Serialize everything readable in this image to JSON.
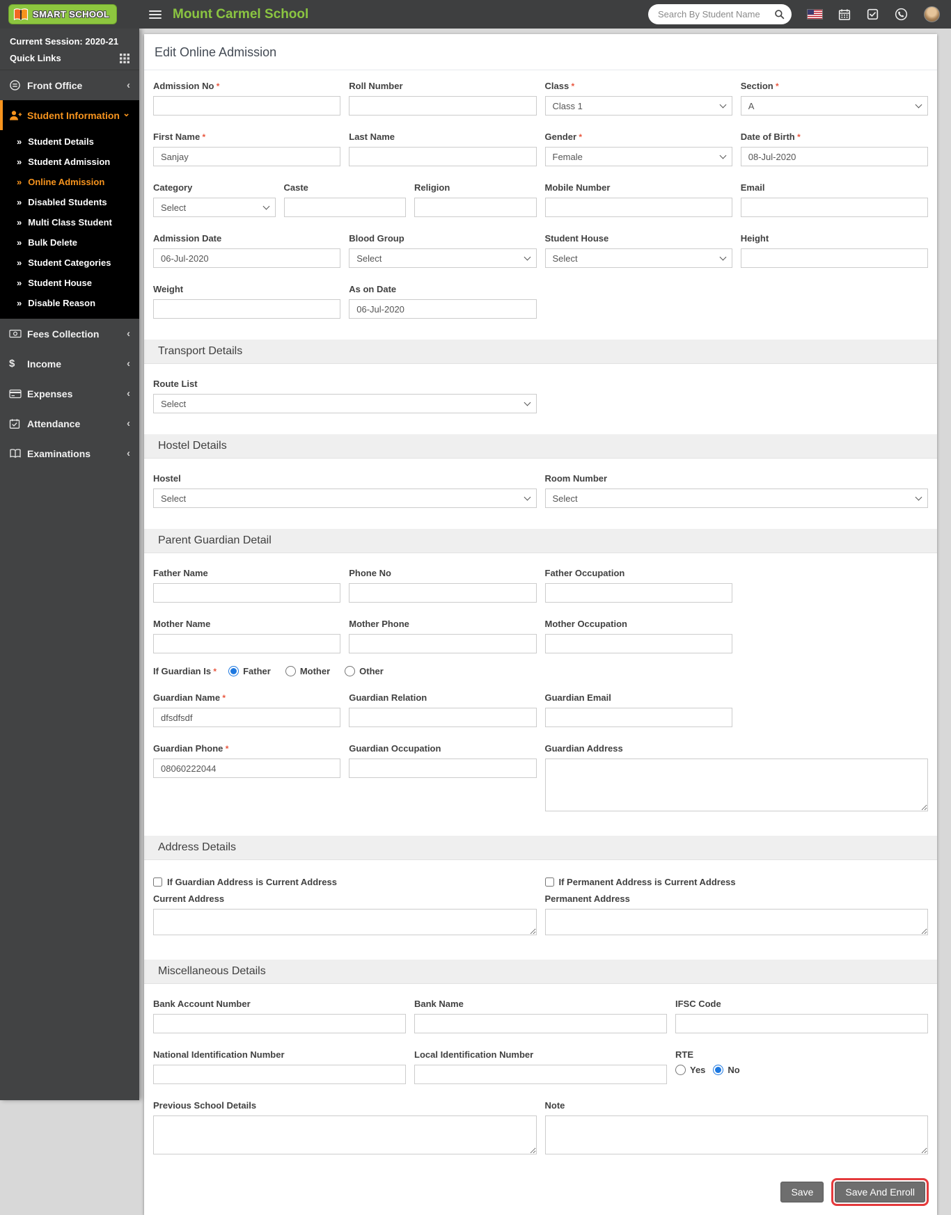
{
  "colors": {
    "accent_orange": "#f7941e",
    "brand_green": "#8bc541",
    "annotation_red": "#e43a3c",
    "radio_blue": "#1d78e0",
    "header_bg": "#3e3f40",
    "sidebar_bg": "#424344"
  },
  "header": {
    "logo_text": "SMART SCHOOL",
    "school_name": "Mount Carmel School",
    "search_placeholder": "Search By Student Name"
  },
  "sidebar": {
    "session": "Current Session: 2020-21",
    "quick_links": "Quick Links",
    "items": [
      {
        "label": "Front Office"
      },
      {
        "label": "Student Information",
        "active": true
      },
      {
        "label": "Fees Collection"
      },
      {
        "label": "Income"
      },
      {
        "label": "Expenses"
      },
      {
        "label": "Attendance"
      },
      {
        "label": "Examinations"
      }
    ],
    "student_information_children": [
      "Student Details",
      "Student Admission",
      "Online Admission",
      "Disabled Students",
      "Multi Class Student",
      "Bulk Delete",
      "Student Categories",
      "Student House",
      "Disable Reason"
    ],
    "active_child": "Online Admission"
  },
  "page": {
    "title": "Edit Online Admission"
  },
  "form": {
    "admission_no": {
      "label": "Admission No",
      "value": "",
      "required": true
    },
    "roll_number": {
      "label": "Roll Number",
      "value": ""
    },
    "class": {
      "label": "Class",
      "value": "Class 1",
      "required": true
    },
    "section": {
      "label": "Section",
      "value": "A",
      "required": true
    },
    "first_name": {
      "label": "First Name",
      "value": "Sanjay",
      "required": true
    },
    "last_name": {
      "label": "Last Name",
      "value": ""
    },
    "gender": {
      "label": "Gender",
      "value": "Female",
      "required": true
    },
    "date_of_birth": {
      "label": "Date of Birth",
      "value": "08-Jul-2020",
      "required": true
    },
    "category": {
      "label": "Category",
      "value": "Select"
    },
    "caste": {
      "label": "Caste",
      "value": ""
    },
    "religion": {
      "label": "Religion",
      "value": ""
    },
    "mobile_number": {
      "label": "Mobile Number",
      "value": ""
    },
    "email": {
      "label": "Email",
      "value": ""
    },
    "admission_date": {
      "label": "Admission Date",
      "value": "06-Jul-2020"
    },
    "blood_group": {
      "label": "Blood Group",
      "value": "Select"
    },
    "student_house": {
      "label": "Student House",
      "value": "Select"
    },
    "height": {
      "label": "Height",
      "value": ""
    },
    "weight": {
      "label": "Weight",
      "value": ""
    },
    "as_on_date": {
      "label": "As on Date",
      "value": "06-Jul-2020"
    }
  },
  "transport": {
    "title": "Transport Details",
    "route_list": {
      "label": "Route List",
      "value": "Select"
    }
  },
  "hostel": {
    "title": "Hostel Details",
    "hostel": {
      "label": "Hostel",
      "value": "Select"
    },
    "room_number": {
      "label": "Room Number",
      "value": "Select"
    }
  },
  "guardian": {
    "title": "Parent Guardian Detail",
    "father_name": {
      "label": "Father Name",
      "value": ""
    },
    "phone_no": {
      "label": "Phone No",
      "value": ""
    },
    "father_occupation": {
      "label": "Father Occupation",
      "value": ""
    },
    "mother_name": {
      "label": "Mother Name",
      "value": ""
    },
    "mother_phone": {
      "label": "Mother Phone",
      "value": ""
    },
    "mother_occupation": {
      "label": "Mother Occupation",
      "value": ""
    },
    "if_guardian_is": {
      "label": "If Guardian Is",
      "options": {
        "father": "Father",
        "mother": "Mother",
        "other": "Other"
      },
      "selected": "Father",
      "required": true
    },
    "guardian_name": {
      "label": "Guardian Name",
      "value": "dfsdfsdf",
      "required": true
    },
    "guardian_relation": {
      "label": "Guardian Relation",
      "value": ""
    },
    "guardian_email": {
      "label": "Guardian Email",
      "value": ""
    },
    "guardian_phone": {
      "label": "Guardian Phone",
      "value": "08060222044",
      "required": true
    },
    "guardian_occupation": {
      "label": "Guardian Occupation",
      "value": ""
    },
    "guardian_address": {
      "label": "Guardian Address",
      "value": ""
    }
  },
  "address": {
    "title": "Address Details",
    "guardian_is_current_checkbox": "If Guardian Address is Current Address",
    "current_address": {
      "label": "Current Address",
      "value": ""
    },
    "permanent_is_current_checkbox": "If Permanent Address is Current Address",
    "permanent_address": {
      "label": "Permanent Address",
      "value": ""
    }
  },
  "misc": {
    "title": "Miscellaneous Details",
    "bank_account_number": {
      "label": "Bank Account Number",
      "value": ""
    },
    "bank_name": {
      "label": "Bank Name",
      "value": ""
    },
    "ifsc_code": {
      "label": "IFSC Code",
      "value": ""
    },
    "national_id": {
      "label": "National Identification Number",
      "value": ""
    },
    "local_id": {
      "label": "Local Identification Number",
      "value": ""
    },
    "rte": {
      "label": "RTE",
      "options": {
        "yes": "Yes",
        "no": "No"
      },
      "selected": "No"
    },
    "previous_school": {
      "label": "Previous School Details",
      "value": ""
    },
    "note": {
      "label": "Note",
      "value": ""
    }
  },
  "footer": {
    "save": "Save",
    "save_and_enroll": "Save And Enroll"
  }
}
